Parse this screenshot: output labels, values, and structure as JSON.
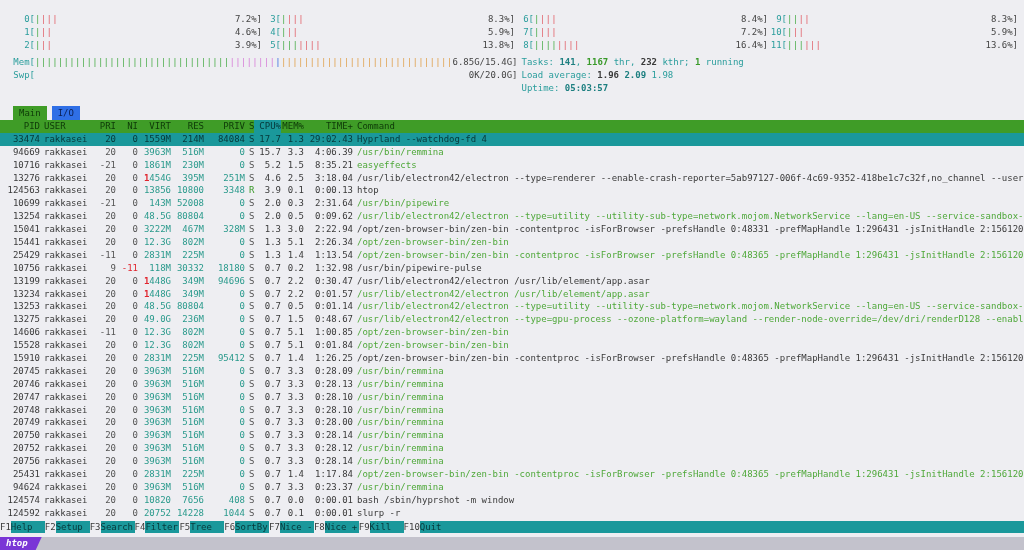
{
  "cpu_columns": [
    [
      {
        "label": "0[",
        "segments": [
          {
            "kind": "user",
            "text": "|"
          },
          {
            "kind": "system",
            "text": "|||"
          }
        ],
        "value": "7.2%]"
      },
      {
        "label": "1[",
        "segments": [
          {
            "kind": "user",
            "text": "|"
          },
          {
            "kind": "system",
            "text": "||"
          }
        ],
        "value": "4.6%]"
      },
      {
        "label": "2[",
        "segments": [
          {
            "kind": "user",
            "text": "|"
          },
          {
            "kind": "system",
            "text": "||"
          }
        ],
        "value": "3.9%]"
      }
    ],
    [
      {
        "label": "3[",
        "segments": [
          {
            "kind": "user",
            "text": "|"
          },
          {
            "kind": "system",
            "text": "|||"
          }
        ],
        "value": "8.3%]"
      },
      {
        "label": "4[",
        "segments": [
          {
            "kind": "user",
            "text": "|"
          },
          {
            "kind": "system",
            "text": "||"
          }
        ],
        "value": "5.9%]"
      },
      {
        "label": "5[",
        "segments": [
          {
            "kind": "user",
            "text": "|||"
          },
          {
            "kind": "system",
            "text": "||||"
          }
        ],
        "value": "13.8%]"
      }
    ],
    [
      {
        "label": "6[",
        "segments": [
          {
            "kind": "user",
            "text": "|"
          },
          {
            "kind": "system",
            "text": "|||"
          }
        ],
        "value": "8.4%]"
      },
      {
        "label": "7[",
        "segments": [
          {
            "kind": "user",
            "text": "|"
          },
          {
            "kind": "system",
            "text": "|||"
          }
        ],
        "value": "7.2%]"
      },
      {
        "label": "8[",
        "segments": [
          {
            "kind": "user",
            "text": "||||"
          },
          {
            "kind": "system",
            "text": "||||"
          }
        ],
        "value": "16.4%]"
      }
    ],
    [
      {
        "label": "9[",
        "segments": [
          {
            "kind": "user",
            "text": "||"
          },
          {
            "kind": "system",
            "text": "||"
          }
        ],
        "value": "8.3%]"
      },
      {
        "label": "10[",
        "segments": [
          {
            "kind": "user",
            "text": "|"
          },
          {
            "kind": "system",
            "text": "||"
          }
        ],
        "value": "5.9%]"
      },
      {
        "label": "11[",
        "segments": [
          {
            "kind": "user",
            "text": "|||"
          },
          {
            "kind": "system",
            "text": "|||"
          }
        ],
        "value": "13.6%]"
      }
    ]
  ],
  "memory": {
    "label": "Mem[",
    "segments": [
      {
        "kind": "user",
        "text": "||||||||||||||||||||||||||||||||||"
      },
      {
        "kind": "shared",
        "text": "||||||||"
      },
      {
        "kind": "buffers",
        "text": "|"
      },
      {
        "kind": "cache",
        "text": "||||||||||||||||||||||||||||||"
      }
    ],
    "value": "6.85G/15.4G]"
  },
  "swap": {
    "label": "Swp[",
    "value": "0K/20.0G]"
  },
  "tasks": [
    {
      "kind": "label",
      "text": "Tasks: "
    },
    {
      "kind": "strong",
      "text": "141"
    },
    {
      "kind": "label",
      "text": ", "
    },
    {
      "kind": "accent",
      "text": "1167"
    },
    {
      "kind": "label",
      "text": " thr, "
    },
    {
      "kind": "plain",
      "text": "232"
    },
    {
      "kind": "label",
      "text": " kthr; "
    },
    {
      "kind": "accent",
      "text": "1"
    },
    {
      "kind": "label",
      "text": " running"
    }
  ],
  "load_average": [
    {
      "kind": "label",
      "text": "Load average: "
    },
    {
      "kind": "plain",
      "text": "1.96 "
    },
    {
      "kind": "strong",
      "text": "2.09 "
    },
    {
      "kind": "label",
      "text": "1.98"
    }
  ],
  "uptime": [
    {
      "kind": "label",
      "text": "Uptime: "
    },
    {
      "kind": "strong",
      "text": "05:03:57"
    }
  ],
  "tabs": [
    {
      "label": "Main",
      "selected": true
    },
    {
      "label": "I/O",
      "selected": false
    }
  ],
  "columns": [
    {
      "label": "PID",
      "selected": false
    },
    {
      "label": "USER",
      "selected": false
    },
    {
      "label": "PRI",
      "selected": false
    },
    {
      "label": "NI",
      "selected": false
    },
    {
      "label": "VIRT",
      "selected": false
    },
    {
      "label": "RES",
      "selected": false
    },
    {
      "label": "PRIV",
      "selected": false
    },
    {
      "label": "S",
      "selected": false
    },
    {
      "label": "CPU%",
      "selected": true
    },
    {
      "label": "MEM%",
      "selected": false
    },
    {
      "label": "TIME+",
      "selected": false
    },
    {
      "label": "Command",
      "selected": false
    }
  ],
  "processes": [
    {
      "selected": true,
      "thread": false,
      "ni_alert": false,
      "running": false,
      "pid": "33474",
      "user": "rakkasei",
      "pri": "20",
      "ni": "0",
      "virt": "1559M",
      "res": "214M",
      "priv": "84084",
      "s": "S",
      "cpu": "17.7",
      "mem": "1.3",
      "time": "29:02.43",
      "command": "Hyprland --watchdog-fd 4"
    },
    {
      "selected": false,
      "thread": true,
      "ni_alert": false,
      "running": false,
      "pid": "94669",
      "user": "rakkasei",
      "pri": "20",
      "ni": "0",
      "virt": "3963M",
      "res": "516M",
      "priv": "0",
      "s": "S",
      "cpu": "15.7",
      "mem": "3.3",
      "time": "4:06.39",
      "command": "/usr/bin/remmina"
    },
    {
      "selected": false,
      "thread": true,
      "ni_alert": false,
      "running": false,
      "pid": "10716",
      "user": "rakkasei",
      "pri": "-21",
      "ni": "0",
      "virt": "1861M",
      "res": "230M",
      "priv": "0",
      "s": "S",
      "cpu": "5.2",
      "mem": "1.5",
      "time": "8:35.21",
      "command": "easyeffects"
    },
    {
      "selected": false,
      "thread": false,
      "ni_alert": false,
      "running": false,
      "pid": "13276",
      "user": "rakkasei",
      "pri": "20",
      "ni": "0",
      "virt_prefix": "1",
      "virt": "454G",
      "res": "395M",
      "priv": "251M",
      "s": "S",
      "cpu": "4.6",
      "mem": "2.5",
      "time": "3:18.04",
      "command": "/usr/lib/electron42/electron --type=renderer --enable-crash-reporter=5ab97127-006f-4c69-9352-418be1c7c32f,no_channel --user"
    },
    {
      "selected": false,
      "thread": false,
      "ni_alert": false,
      "running": true,
      "pid": "124563",
      "user": "rakkasei",
      "pri": "20",
      "ni": "0",
      "virt": "13856",
      "res": "10800",
      "priv": "3348",
      "s": "R",
      "cpu": "3.9",
      "mem": "0.1",
      "time": "0:00.13",
      "command": "htop"
    },
    {
      "selected": false,
      "thread": true,
      "ni_alert": false,
      "running": false,
      "pid": "10699",
      "user": "rakkasei",
      "pri": "-21",
      "ni": "0",
      "virt": "143M",
      "res": "52008",
      "priv": "0",
      "s": "S",
      "cpu": "2.0",
      "mem": "0.3",
      "time": "2:31.64",
      "command": "/usr/bin/pipewire"
    },
    {
      "selected": false,
      "thread": true,
      "ni_alert": false,
      "running": false,
      "pid": "13254",
      "user": "rakkasei",
      "pri": "20",
      "ni": "0",
      "virt": "48.5G",
      "res": "80804",
      "priv": "0",
      "s": "S",
      "cpu": "2.0",
      "mem": "0.5",
      "time": "0:09.62",
      "command": "/usr/lib/electron42/electron --type=utility --utility-sub-type=network.mojom.NetworkService --lang=en-US --service-sandbox-"
    },
    {
      "selected": false,
      "thread": false,
      "ni_alert": false,
      "running": false,
      "pid": "15041",
      "user": "rakkasei",
      "pri": "20",
      "ni": "0",
      "virt": "3222M",
      "res": "467M",
      "priv": "328M",
      "s": "S",
      "cpu": "1.3",
      "mem": "3.0",
      "time": "2:22.94",
      "command": "/opt/zen-browser-bin/zen-bin -contentproc -isForBrowser -prefsHandle 0:48331 -prefMapHandle 1:296431 -jsInitHandle 2:156120"
    },
    {
      "selected": false,
      "thread": true,
      "ni_alert": false,
      "running": false,
      "pid": "15441",
      "user": "rakkasei",
      "pri": "20",
      "ni": "0",
      "virt": "12.3G",
      "res": "802M",
      "priv": "0",
      "s": "S",
      "cpu": "1.3",
      "mem": "5.1",
      "time": "2:26.34",
      "command": "/opt/zen-browser-bin/zen-bin"
    },
    {
      "selected": false,
      "thread": true,
      "ni_alert": false,
      "running": false,
      "pid": "25429",
      "user": "rakkasei",
      "pri": "-11",
      "ni": "0",
      "virt": "2831M",
      "res": "225M",
      "priv": "0",
      "s": "S",
      "cpu": "1.3",
      "mem": "1.4",
      "time": "1:13.54",
      "command": "/opt/zen-browser-bin/zen-bin -contentproc -isForBrowser -prefsHandle 0:48365 -prefMapHandle 1:296431 -jsInitHandle 2:156120"
    },
    {
      "selected": false,
      "thread": false,
      "ni_alert": true,
      "running": false,
      "pid": "10756",
      "user": "rakkasei",
      "pri": "9",
      "ni": "-11",
      "virt": "118M",
      "res": "30332",
      "priv": "18180",
      "s": "S",
      "cpu": "0.7",
      "mem": "0.2",
      "time": "1:32.98",
      "command": "/usr/bin/pipewire-pulse"
    },
    {
      "selected": false,
      "thread": false,
      "ni_alert": false,
      "running": false,
      "pid": "13199",
      "user": "rakkasei",
      "pri": "20",
      "ni": "0",
      "virt_prefix": "1",
      "virt": "448G",
      "res": "349M",
      "priv": "94696",
      "s": "S",
      "cpu": "0.7",
      "mem": "2.2",
      "time": "0:30.47",
      "command": "/usr/lib/electron42/electron /usr/lib/element/app.asar"
    },
    {
      "selected": false,
      "thread": true,
      "ni_alert": false,
      "running": false,
      "pid": "13234",
      "user": "rakkasei",
      "pri": "20",
      "ni": "0",
      "virt_prefix": "1",
      "virt": "448G",
      "res": "349M",
      "priv": "0",
      "s": "S",
      "cpu": "0.7",
      "mem": "2.2",
      "time": "0:01.57",
      "command": "/usr/lib/electron42/electron /usr/lib/element/app.asar"
    },
    {
      "selected": false,
      "thread": true,
      "ni_alert": false,
      "running": false,
      "pid": "13253",
      "user": "rakkasei",
      "pri": "20",
      "ni": "0",
      "virt": "48.5G",
      "res": "80804",
      "priv": "0",
      "s": "S",
      "cpu": "0.7",
      "mem": "0.5",
      "time": "0:01.14",
      "command": "/usr/lib/electron42/electron --type=utility --utility-sub-type=network.mojom.NetworkService --lang=en-US --service-sandbox-"
    },
    {
      "selected": false,
      "thread": true,
      "ni_alert": false,
      "running": false,
      "pid": "13275",
      "user": "rakkasei",
      "pri": "20",
      "ni": "0",
      "virt": "49.0G",
      "res": "236M",
      "priv": "0",
      "s": "S",
      "cpu": "0.7",
      "mem": "1.5",
      "time": "0:48.67",
      "command": "/usr/lib/electron42/electron --type=gpu-process --ozone-platform=wayland --render-node-override=/dev/dri/renderD128 --enabl"
    },
    {
      "selected": false,
      "thread": true,
      "ni_alert": false,
      "running": false,
      "pid": "14606",
      "user": "rakkasei",
      "pri": "-11",
      "ni": "0",
      "virt": "12.3G",
      "res": "802M",
      "priv": "0",
      "s": "S",
      "cpu": "0.7",
      "mem": "5.1",
      "time": "1:00.85",
      "command": "/opt/zen-browser-bin/zen-bin"
    },
    {
      "selected": false,
      "thread": true,
      "ni_alert": false,
      "running": false,
      "pid": "15528",
      "user": "rakkasei",
      "pri": "20",
      "ni": "0",
      "virt": "12.3G",
      "res": "802M",
      "priv": "0",
      "s": "S",
      "cpu": "0.7",
      "mem": "5.1",
      "time": "0:01.84",
      "command": "/opt/zen-browser-bin/zen-bin"
    },
    {
      "selected": false,
      "thread": false,
      "ni_alert": false,
      "running": false,
      "pid": "15910",
      "user": "rakkasei",
      "pri": "20",
      "ni": "0",
      "virt": "2831M",
      "res": "225M",
      "priv": "95412",
      "s": "S",
      "cpu": "0.7",
      "mem": "1.4",
      "time": "1:26.25",
      "command": "/opt/zen-browser-bin/zen-bin -contentproc -isForBrowser -prefsHandle 0:48365 -prefMapHandle 1:296431 -jsInitHandle 2:156120"
    },
    {
      "selected": false,
      "thread": true,
      "ni_alert": false,
      "running": false,
      "pid": "20745",
      "user": "rakkasei",
      "pri": "20",
      "ni": "0",
      "virt": "3963M",
      "res": "516M",
      "priv": "0",
      "s": "S",
      "cpu": "0.7",
      "mem": "3.3",
      "time": "0:28.09",
      "command": "/usr/bin/remmina"
    },
    {
      "selected": false,
      "thread": true,
      "ni_alert": false,
      "running": false,
      "pid": "20746",
      "user": "rakkasei",
      "pri": "20",
      "ni": "0",
      "virt": "3963M",
      "res": "516M",
      "priv": "0",
      "s": "S",
      "cpu": "0.7",
      "mem": "3.3",
      "time": "0:28.13",
      "command": "/usr/bin/remmina"
    },
    {
      "selected": false,
      "thread": true,
      "ni_alert": false,
      "running": false,
      "pid": "20747",
      "user": "rakkasei",
      "pri": "20",
      "ni": "0",
      "virt": "3963M",
      "res": "516M",
      "priv": "0",
      "s": "S",
      "cpu": "0.7",
      "mem": "3.3",
      "time": "0:28.10",
      "command": "/usr/bin/remmina"
    },
    {
      "selected": false,
      "thread": true,
      "ni_alert": false,
      "running": false,
      "pid": "20748",
      "user": "rakkasei",
      "pri": "20",
      "ni": "0",
      "virt": "3963M",
      "res": "516M",
      "priv": "0",
      "s": "S",
      "cpu": "0.7",
      "mem": "3.3",
      "time": "0:28.10",
      "command": "/usr/bin/remmina"
    },
    {
      "selected": false,
      "thread": true,
      "ni_alert": false,
      "running": false,
      "pid": "20749",
      "user": "rakkasei",
      "pri": "20",
      "ni": "0",
      "virt": "3963M",
      "res": "516M",
      "priv": "0",
      "s": "S",
      "cpu": "0.7",
      "mem": "3.3",
      "time": "0:28.00",
      "command": "/usr/bin/remmina"
    },
    {
      "selected": false,
      "thread": true,
      "ni_alert": false,
      "running": false,
      "pid": "20750",
      "user": "rakkasei",
      "pri": "20",
      "ni": "0",
      "virt": "3963M",
      "res": "516M",
      "priv": "0",
      "s": "S",
      "cpu": "0.7",
      "mem": "3.3",
      "time": "0:28.14",
      "command": "/usr/bin/remmina"
    },
    {
      "selected": false,
      "thread": true,
      "ni_alert": false,
      "running": false,
      "pid": "20752",
      "user": "rakkasei",
      "pri": "20",
      "ni": "0",
      "virt": "3963M",
      "res": "516M",
      "priv": "0",
      "s": "S",
      "cpu": "0.7",
      "mem": "3.3",
      "time": "0:28.12",
      "command": "/usr/bin/remmina"
    },
    {
      "selected": false,
      "thread": true,
      "ni_alert": false,
      "running": false,
      "pid": "20756",
      "user": "rakkasei",
      "pri": "20",
      "ni": "0",
      "virt": "3963M",
      "res": "516M",
      "priv": "0",
      "s": "S",
      "cpu": "0.7",
      "mem": "3.3",
      "time": "0:28.14",
      "command": "/usr/bin/remmina"
    },
    {
      "selected": false,
      "thread": true,
      "ni_alert": false,
      "running": false,
      "pid": "25431",
      "user": "rakkasei",
      "pri": "20",
      "ni": "0",
      "virt": "2831M",
      "res": "225M",
      "priv": "0",
      "s": "S",
      "cpu": "0.7",
      "mem": "1.4",
      "time": "1:17.84",
      "command": "/opt/zen-browser-bin/zen-bin -contentproc -isForBrowser -prefsHandle 0:48365 -prefMapHandle 1:296431 -jsInitHandle 2:156120"
    },
    {
      "selected": false,
      "thread": true,
      "ni_alert": false,
      "running": false,
      "pid": "94624",
      "user": "rakkasei",
      "pri": "20",
      "ni": "0",
      "virt": "3963M",
      "res": "516M",
      "priv": "0",
      "s": "S",
      "cpu": "0.7",
      "mem": "3.3",
      "time": "0:23.37",
      "command": "/usr/bin/remmina"
    },
    {
      "selected": false,
      "thread": false,
      "ni_alert": false,
      "running": false,
      "pid": "124574",
      "user": "rakkasei",
      "pri": "20",
      "ni": "0",
      "virt": "10820",
      "res": "7656",
      "priv": "408",
      "s": "S",
      "cpu": "0.7",
      "mem": "0.0",
      "time": "0:00.01",
      "command": "bash /sbin/hyprshot -m window"
    },
    {
      "selected": false,
      "thread": false,
      "ni_alert": false,
      "running": false,
      "pid": "124592",
      "user": "rakkasei",
      "pri": "20",
      "ni": "0",
      "virt": "20752",
      "res": "14228",
      "priv": "1044",
      "s": "S",
      "cpu": "0.7",
      "mem": "0.1",
      "time": "0:00.01",
      "command": "slurp -r"
    }
  ],
  "function_keys": [
    {
      "key": "F1",
      "label": "Help"
    },
    {
      "key": "F2",
      "label": "Setup"
    },
    {
      "key": "F3",
      "label": "Search"
    },
    {
      "key": "F4",
      "label": "Filter"
    },
    {
      "key": "F5",
      "label": "Tree"
    },
    {
      "key": "F6",
      "label": "SortBy"
    },
    {
      "key": "F7",
      "label": "Nice -"
    },
    {
      "key": "F8",
      "label": "Nice +"
    },
    {
      "key": "F9",
      "label": "Kill"
    },
    {
      "key": "F10",
      "label": "Quit"
    }
  ],
  "status_bar": {
    "title": "htop"
  }
}
